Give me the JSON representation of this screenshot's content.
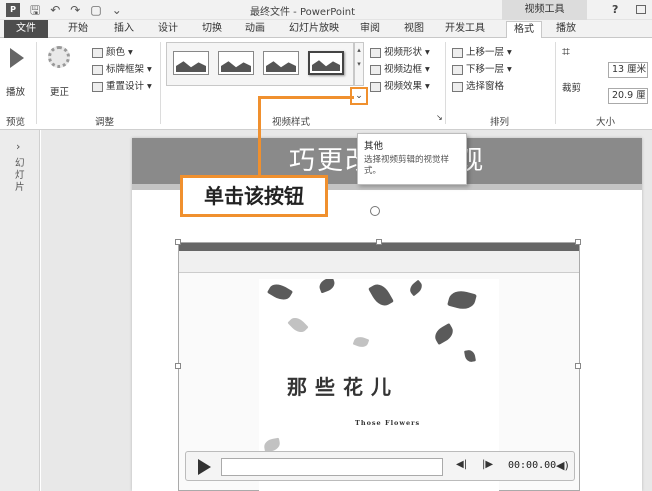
{
  "window": {
    "title": "最终文件 - PowerPoint",
    "context_group": "视频工具",
    "help": "?"
  },
  "qat": {
    "logo": "P",
    "save": "🖫",
    "undo": "↶",
    "redo": "↷",
    "new": "▢",
    "more": "⌄"
  },
  "tabs": [
    "文件",
    "开始",
    "插入",
    "设计",
    "切换",
    "动画",
    "幻灯片放映",
    "审阅",
    "视图",
    "开发工具",
    "格式",
    "播放"
  ],
  "active_tab": "格式",
  "ribbon": {
    "preview": {
      "button": "播放",
      "group": "预览"
    },
    "adjust": {
      "correct": "更正",
      "color": "颜色 ▾",
      "poster": "标牌框架 ▾",
      "reset": "重置设计 ▾",
      "group": "调整"
    },
    "styles": {
      "shape": "视频形状 ▾",
      "border": "视频边框 ▾",
      "effects": "视频效果 ▾",
      "group": "视频样式",
      "more_button": "⌄"
    },
    "arrange": {
      "forward": "上移一层 ▾",
      "backward": "下移一层 ▾",
      "selection": "选择窗格",
      "group": "排列"
    },
    "size": {
      "crop": "裁剪",
      "height": "13 厘米",
      "width": "20.9 厘",
      "group": "大小"
    }
  },
  "tooltip": {
    "title": "其他",
    "description": "选择视频剪辑的视觉样式。"
  },
  "callout": {
    "text": "单击该按钮"
  },
  "slide_pane": {
    "arrow": "›",
    "label": "幻灯片"
  },
  "slide": {
    "title": "巧更改视频外观"
  },
  "video": {
    "poem_title": "那些花儿",
    "poem_subtitle": "Those Flowers"
  },
  "player": {
    "time": "00:00.00",
    "back": "◀|",
    "forward": "|▶",
    "volume": "◀)"
  }
}
